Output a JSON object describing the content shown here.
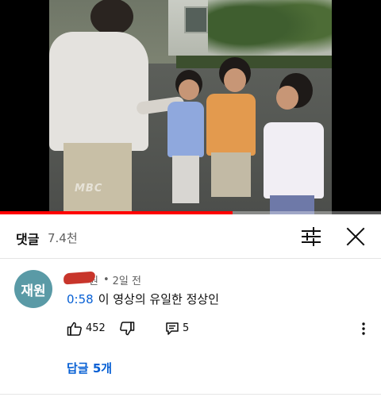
{
  "player": {
    "watermark": "MBC",
    "progress": 0.61
  },
  "comments": {
    "title": "댓글",
    "count": "7.4천",
    "filter_icon": "sort-filter-icon",
    "close_icon": "close-icon"
  },
  "comment": {
    "avatar_text": "재원",
    "avatar_color": "#5a9aa6",
    "author_visible_fragment": "원",
    "separator": "•",
    "time": "2일 전",
    "timestamp_link": "0:58",
    "text": "이 영상의 유일한 정상인",
    "like_count": "452",
    "reply_count": "5",
    "replies_link": "답글 5개"
  },
  "colors": {
    "link_blue": "#065fd4",
    "progress_red": "#ff0000"
  }
}
